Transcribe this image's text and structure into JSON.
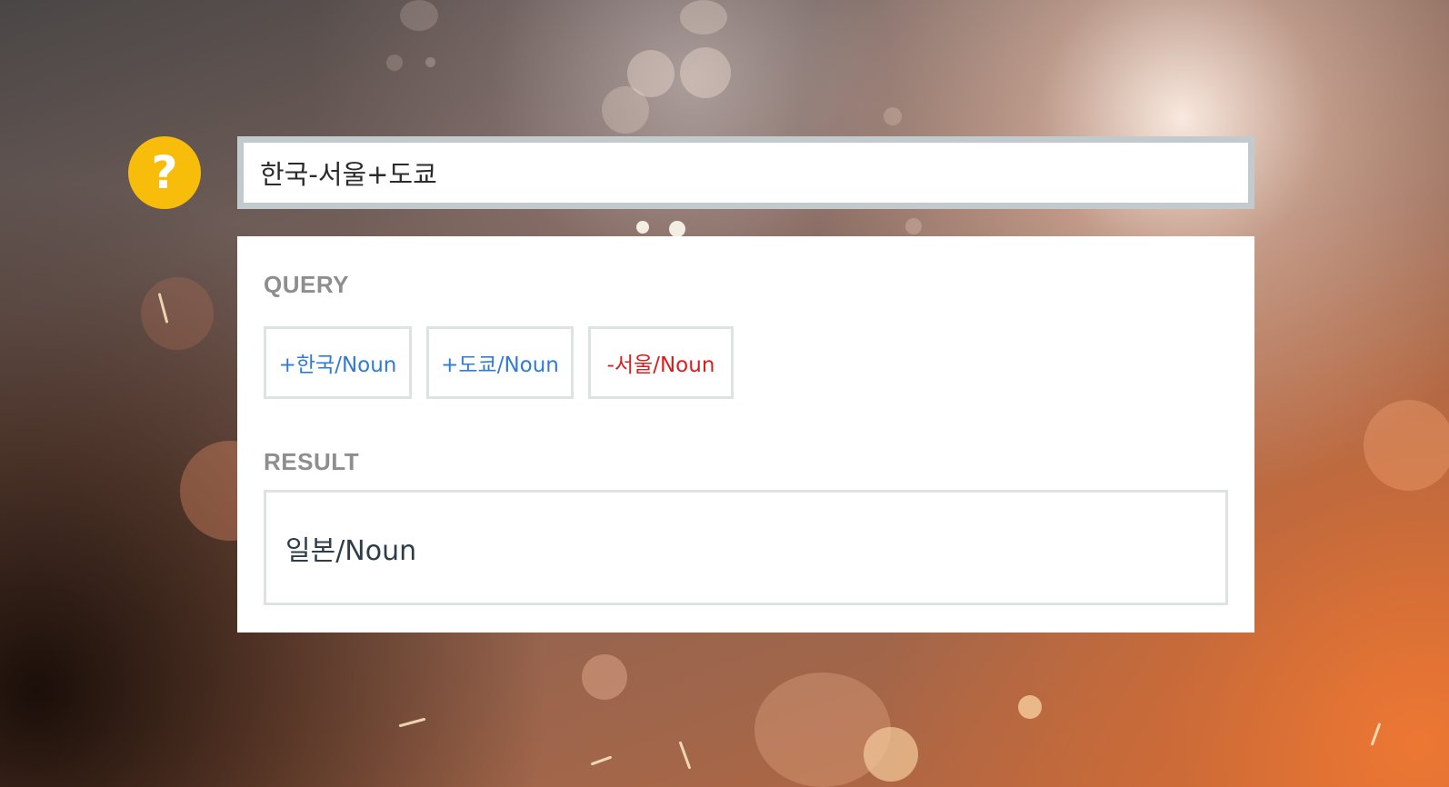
{
  "help_button": {
    "symbol": "?",
    "icon": "question-icon",
    "color": "#f8bc0b"
  },
  "search": {
    "value": "한국-서울+도쿄"
  },
  "query_section": {
    "label": "QUERY",
    "tags": [
      {
        "text": "+한국/Noun",
        "sign": "plus",
        "color": "#2f7bd6"
      },
      {
        "text": "+도쿄/Noun",
        "sign": "plus",
        "color": "#2f7bd6"
      },
      {
        "text": "-서울/Noun",
        "sign": "minus",
        "color": "#d61f1f"
      }
    ]
  },
  "result_section": {
    "label": "RESULT",
    "value": "일본/Noun"
  }
}
